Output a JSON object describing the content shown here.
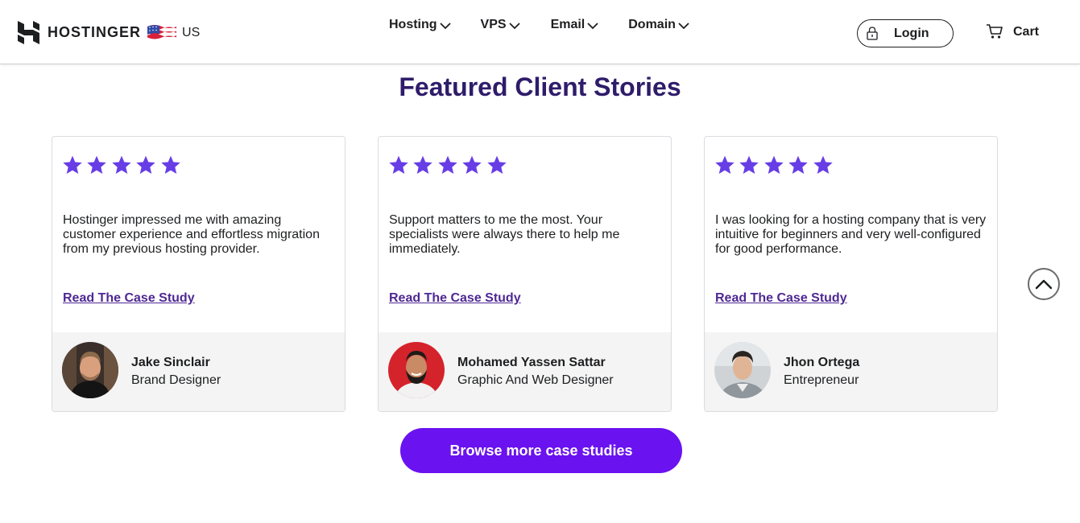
{
  "header": {
    "brand": "HOSTINGER",
    "region": "US",
    "nav": [
      {
        "label": "Hosting"
      },
      {
        "label": "VPS"
      },
      {
        "label": "Email"
      },
      {
        "label": "Domain"
      }
    ],
    "login_label": "Login",
    "cart_label": "Cart"
  },
  "section": {
    "title": "Featured Client Stories"
  },
  "colors": {
    "title": "#2f1c6a",
    "star": "#673de6",
    "link": "#4f2893",
    "button": "#6a12f0"
  },
  "rating": 5,
  "testimonials": [
    {
      "quote": "Hostinger impressed me with amazing customer experience and effortless migration from my previous hosting provider.",
      "link_label": "Read The Case Study",
      "name": "Jake Sinclair",
      "role": "Brand Designer"
    },
    {
      "quote": "Support matters to me the most. Your specialists were always there to help me immediately.",
      "link_label": "Read The Case Study",
      "name": "Mohamed Yassen Sattar",
      "role": "Graphic And Web Designer"
    },
    {
      "quote": "I was looking for a hosting company that is very intuitive for beginners and very well-configured for good performance.",
      "link_label": "Read The Case Study",
      "name": "Jhon Ortega",
      "role": "Entrepreneur"
    }
  ],
  "cta": {
    "label": "Browse more case studies"
  },
  "icons": {
    "logo": "hostinger-logo-icon",
    "flag": "us-flag-icon",
    "chevron": "chevron-down-icon",
    "lock": "lock-icon",
    "cart": "cart-icon",
    "star": "star-icon",
    "scroll_top": "chevron-up-icon"
  }
}
